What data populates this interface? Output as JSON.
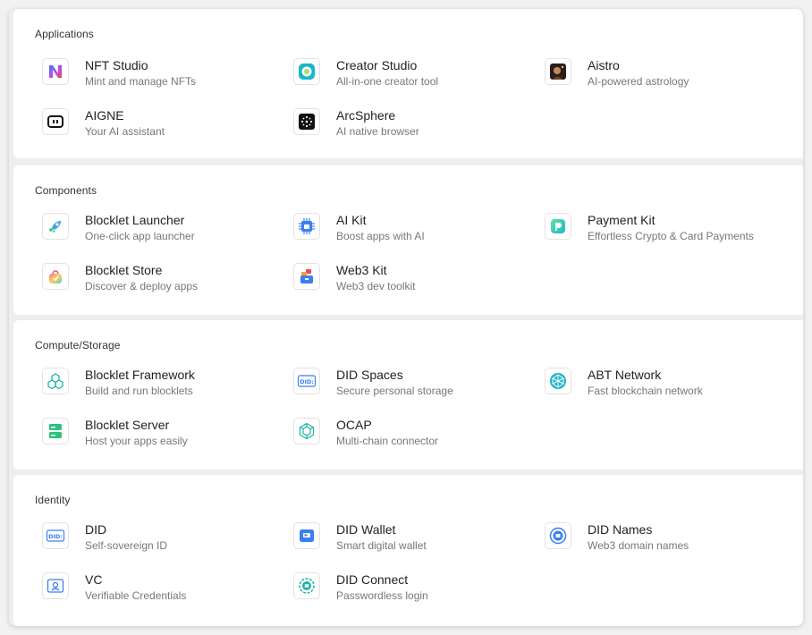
{
  "sections": [
    {
      "title": "Applications",
      "items": [
        {
          "name": "NFT Studio",
          "desc": "Mint and manage NFTs",
          "icon": "nft-studio-icon"
        },
        {
          "name": "Creator Studio",
          "desc": "All-in-one creator tool",
          "icon": "creator-studio-icon"
        },
        {
          "name": "Aistro",
          "desc": "AI-powered astrology",
          "icon": "aistro-icon"
        },
        {
          "name": "AIGNE",
          "desc": "Your AI assistant",
          "icon": "aigne-icon"
        },
        {
          "name": "ArcSphere",
          "desc": "AI native browser",
          "icon": "arcsphere-icon"
        }
      ]
    },
    {
      "title": "Components",
      "items": [
        {
          "name": "Blocklet Launcher",
          "desc": "One-click app launcher",
          "icon": "rocket-icon"
        },
        {
          "name": "AI Kit",
          "desc": "Boost apps with AI",
          "icon": "ai-kit-chip-icon"
        },
        {
          "name": "Payment Kit",
          "desc": "Effortless Crypto & Card Payments",
          "icon": "payment-kit-icon"
        },
        {
          "name": "Blocklet Store",
          "desc": "Discover & deploy apps",
          "icon": "store-bag-icon"
        },
        {
          "name": "Web3 Kit",
          "desc": "Web3 dev toolkit",
          "icon": "web3-kit-icon"
        }
      ]
    },
    {
      "title": "Compute/Storage",
      "items": [
        {
          "name": "Blocklet Framework",
          "desc": "Build and run blocklets",
          "icon": "framework-icon"
        },
        {
          "name": "DID Spaces",
          "desc": "Secure personal storage",
          "icon": "did-spaces-icon"
        },
        {
          "name": "ABT Network",
          "desc": "Fast blockchain network",
          "icon": "abt-network-icon"
        },
        {
          "name": "Blocklet Server",
          "desc": "Host your apps easily",
          "icon": "server-icon"
        },
        {
          "name": "OCAP",
          "desc": "Multi-chain connector",
          "icon": "ocap-icon"
        }
      ]
    },
    {
      "title": "Identity",
      "items": [
        {
          "name": "DID",
          "desc": "Self-sovereign ID",
          "icon": "did-icon"
        },
        {
          "name": "DID Wallet",
          "desc": "Smart digital wallet",
          "icon": "wallet-icon"
        },
        {
          "name": "DID Names",
          "desc": "Web3 domain names",
          "icon": "did-names-icon"
        },
        {
          "name": "VC",
          "desc": "Verifiable Credentials",
          "icon": "vc-icon"
        },
        {
          "name": "DID Connect",
          "desc": "Passwordless login",
          "icon": "did-connect-icon"
        }
      ]
    }
  ],
  "icon_labels": {
    "did_text": "DID:"
  },
  "colors": {
    "accent_blue": "#3b7ff0",
    "accent_teal": "#23b3a6",
    "accent_green": "#2ec27e"
  }
}
